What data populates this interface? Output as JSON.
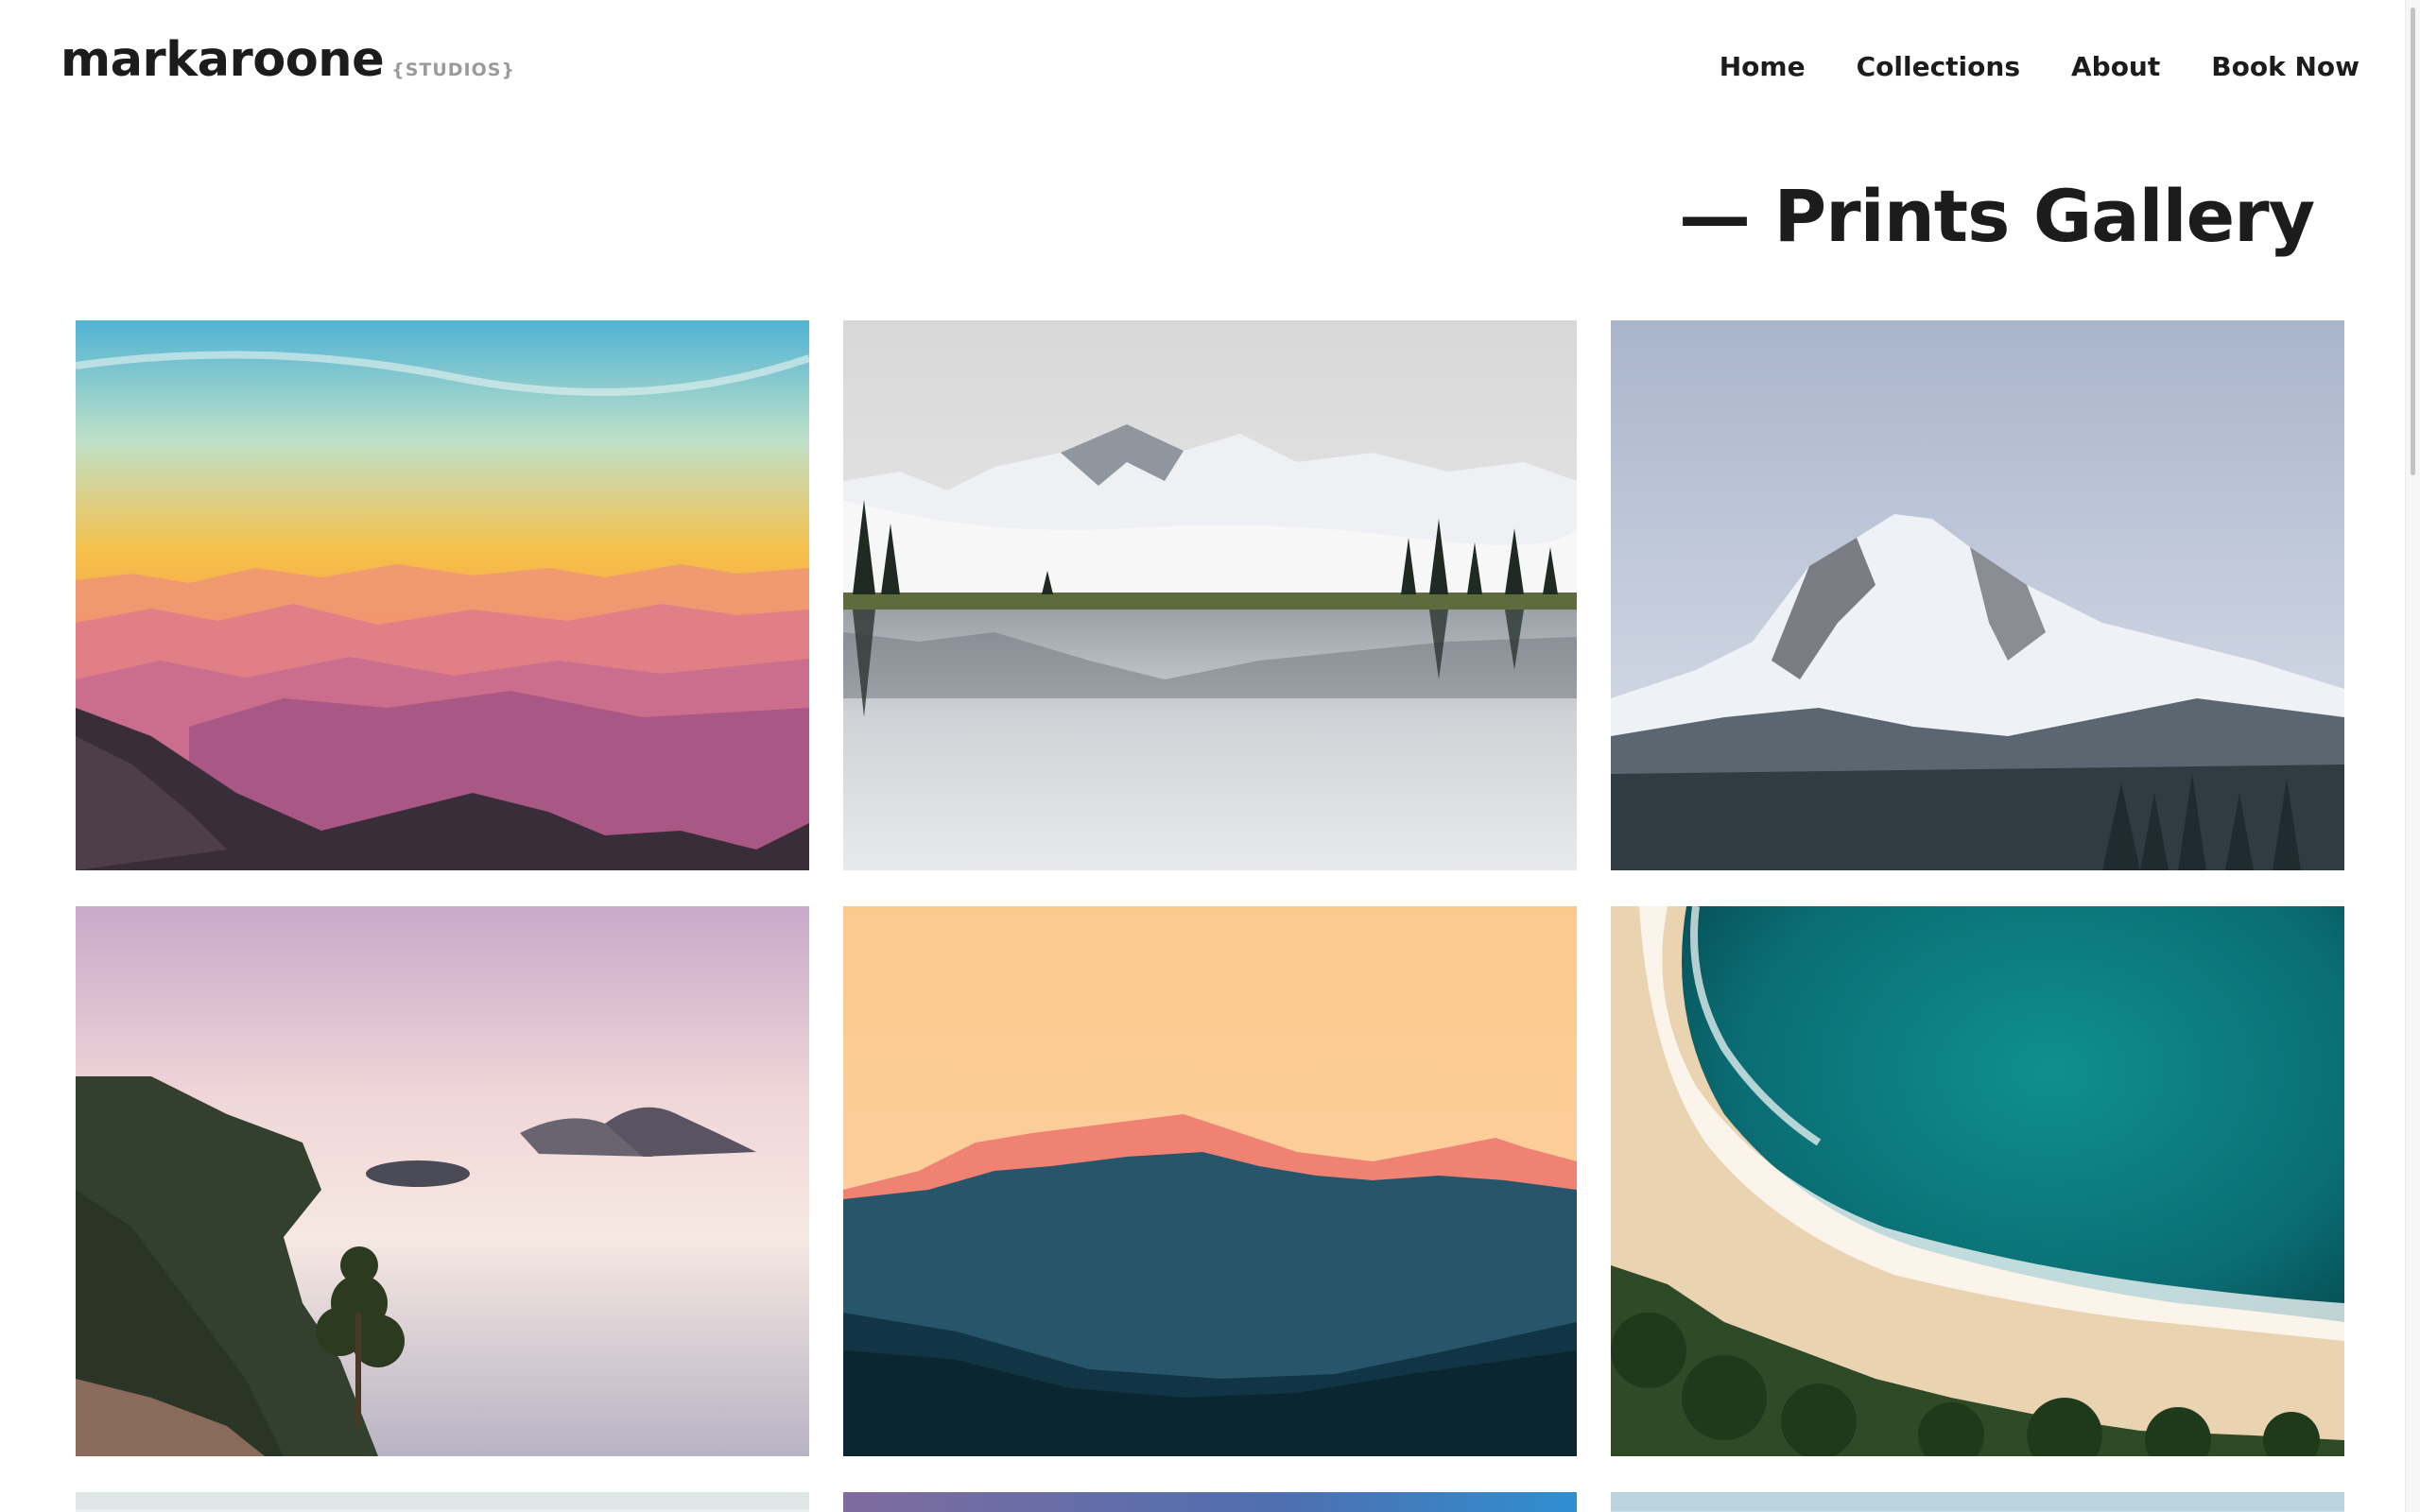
{
  "header": {
    "brand": "markaroone",
    "brand_sub": "{STUDIOS}",
    "nav": [
      {
        "label": "Home"
      },
      {
        "label": "Collections"
      },
      {
        "label": "About"
      },
      {
        "label": "Book Now"
      }
    ]
  },
  "page": {
    "title": "— Prints Gallery"
  },
  "gallery": {
    "items": [
      {
        "subject": "sunset-mountain-layers"
      },
      {
        "subject": "snowy-peaks-lake-reflection"
      },
      {
        "subject": "snowy-mountain-peak"
      },
      {
        "subject": "coastal-islands-sunrise"
      },
      {
        "subject": "peach-sky-mountain-silhouette"
      },
      {
        "subject": "turquoise-ocean-beach-aerial"
      },
      {
        "subject": "partial-image-7"
      },
      {
        "subject": "partial-image-8"
      },
      {
        "subject": "partial-image-9"
      }
    ]
  },
  "colors": {
    "text": "#1c1c1c",
    "muted": "#9a9a9a",
    "background": "#ffffff"
  }
}
